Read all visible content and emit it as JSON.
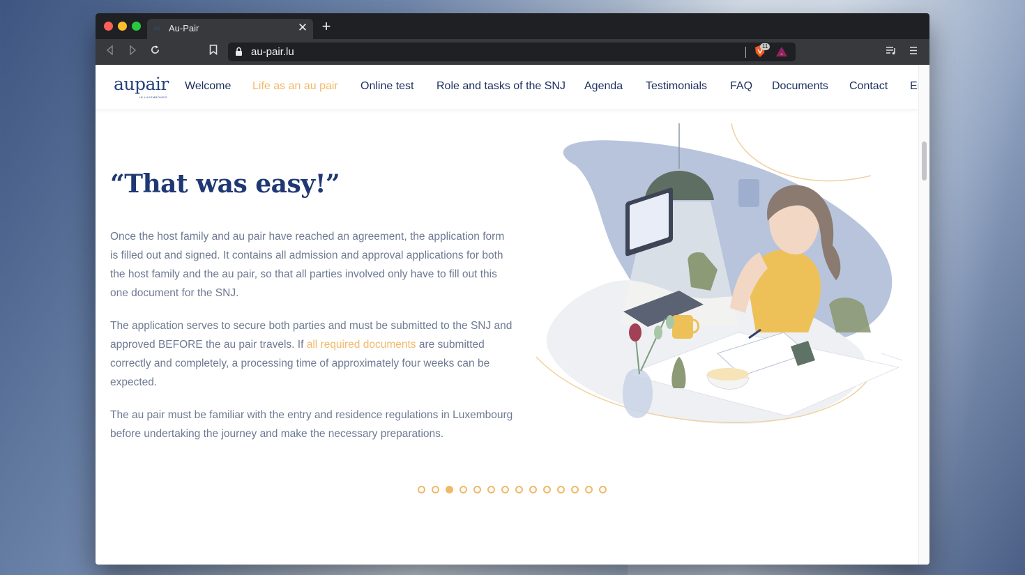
{
  "browser": {
    "tab_title": "Au-Pair",
    "tab_favicon": "au",
    "tab_close": "✕",
    "new_tab": "+",
    "url": "au-pair.lu",
    "shield_count": "11"
  },
  "site": {
    "logo": "aupair",
    "logo_sub": "IN LUXEMBOURG",
    "nav": [
      {
        "label": "Welcome"
      },
      {
        "label": "Life as an au pair",
        "active": true
      },
      {
        "label": "Online test"
      },
      {
        "label": "Role and tasks of the SNJ"
      },
      {
        "label": "Agenda"
      },
      {
        "label": "Testimonials"
      },
      {
        "label": "FAQ"
      },
      {
        "label": "Documents"
      },
      {
        "label": "Contact"
      },
      {
        "label": "En"
      }
    ]
  },
  "content": {
    "headline": "“That was easy!”",
    "p1": "Once the host family and au pair have reached an agreement, the application form is filled out and signed. It contains all admission and approval applications for both the host family and the au pair, so that all parties involved only have to fill out this one document for the SNJ.",
    "p2_before": "The application serves to secure both parties and must be submitted to the SNJ and approved BEFORE the au pair travels. If ",
    "p2_link": "all required documents",
    "p2_after": " are submitted correctly and completely, a processing time of approximately four weeks can be expected.",
    "p3": "The au pair must be familiar with the entry and residence regulations in Luxembourg before undertaking the journey and make the necessary preparations."
  },
  "carousel": {
    "total": 14,
    "active_index": 2
  },
  "colors": {
    "accent": "#f1b968",
    "navy": "#1f3874",
    "body_text": "#6e7a92"
  },
  "icons": [
    "back-icon",
    "forward-icon",
    "reload-icon",
    "bookmark-icon",
    "lock-icon",
    "brave-shield-icon",
    "bat-rewards-icon",
    "media-icon",
    "menu-icon",
    "close-icon",
    "plus-icon"
  ]
}
